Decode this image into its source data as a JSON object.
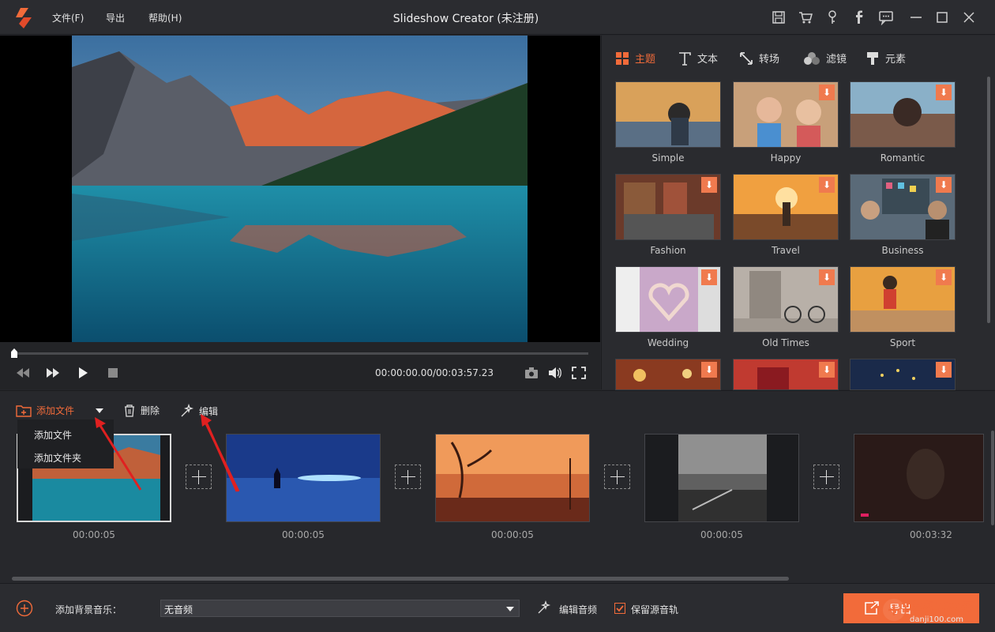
{
  "app": {
    "title": "Slideshow Creator (未注册)"
  },
  "menu": {
    "file": "文件(F)",
    "export": "导出",
    "help": "帮助(H)"
  },
  "player": {
    "timecode": "00:00:00.00/00:03:57.23",
    "progress": 0
  },
  "panel_tabs": [
    {
      "label": "主题",
      "active": true
    },
    {
      "label": "文本"
    },
    {
      "label": "转场"
    },
    {
      "label": "滤镜"
    },
    {
      "label": "元素"
    }
  ],
  "themes": [
    {
      "label": "Simple",
      "downloadable": false
    },
    {
      "label": "Happy",
      "downloadable": true
    },
    {
      "label": "Romantic",
      "downloadable": true
    },
    {
      "label": "Fashion",
      "downloadable": true
    },
    {
      "label": "Travel",
      "downloadable": true
    },
    {
      "label": "Business",
      "downloadable": true
    },
    {
      "label": "Wedding",
      "downloadable": true
    },
    {
      "label": "Old Times",
      "downloadable": true
    },
    {
      "label": "Sport",
      "downloadable": true
    }
  ],
  "toolbar": {
    "add_file": "添加文件",
    "delete": "删除",
    "edit": "编辑"
  },
  "dropdown": {
    "items": [
      "添加文件",
      "添加文件夹"
    ]
  },
  "clips": [
    {
      "time": "00:00:05"
    },
    {
      "time": "00:00:05"
    },
    {
      "time": "00:00:05"
    },
    {
      "time": "00:00:05"
    },
    {
      "time": "00:03:32"
    }
  ],
  "bottom": {
    "bg_music_label": "添加背景音乐：",
    "music_value": "无音频",
    "edit_audio": "编辑音频",
    "keep_audio": "保留源音轨",
    "keep_audio_checked": true,
    "export_label": "导出"
  },
  "watermark": {
    "text": "单机100网",
    "url": "danji100.com"
  },
  "colors": {
    "accent": "#f26b3a",
    "bg": "#26272b",
    "panel": "#2a2b2f"
  }
}
